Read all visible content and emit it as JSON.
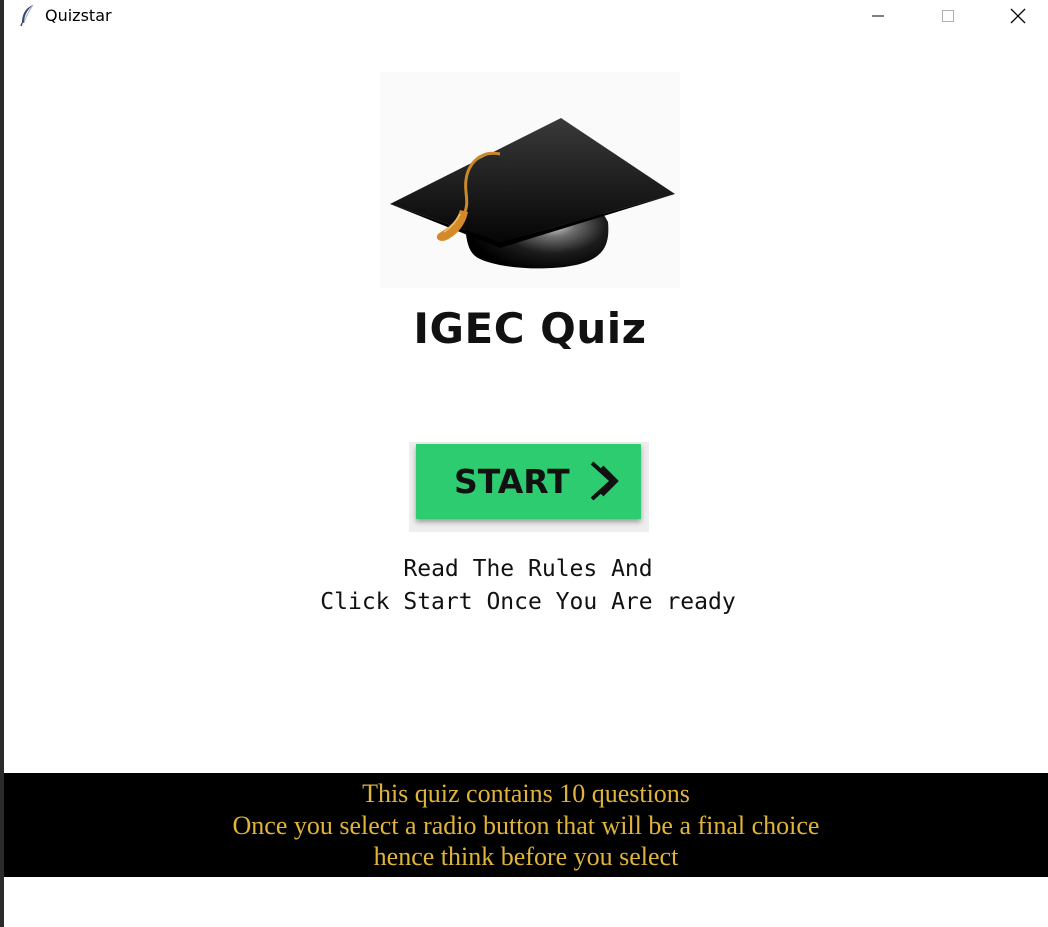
{
  "window": {
    "title": "Quizstar",
    "icon": "feather-icon",
    "controls": [
      "minimize-icon",
      "maximize-icon",
      "close-icon"
    ]
  },
  "main": {
    "logo": "graduation-cap-icon",
    "title": "IGEC Quiz",
    "start_button": {
      "label": "START",
      "icon": "double-chevron-right-icon",
      "color": "#2ecc71"
    },
    "instructions": [
      "Read The Rules And",
      "Click Start Once You Are ready"
    ]
  },
  "rules_bar": {
    "lines": [
      "This quiz contains 10 questions",
      "Once you select a radio button that will be a final choice",
      "hence think before you select"
    ],
    "text_color": "#e0b43a",
    "background": "#000000"
  }
}
